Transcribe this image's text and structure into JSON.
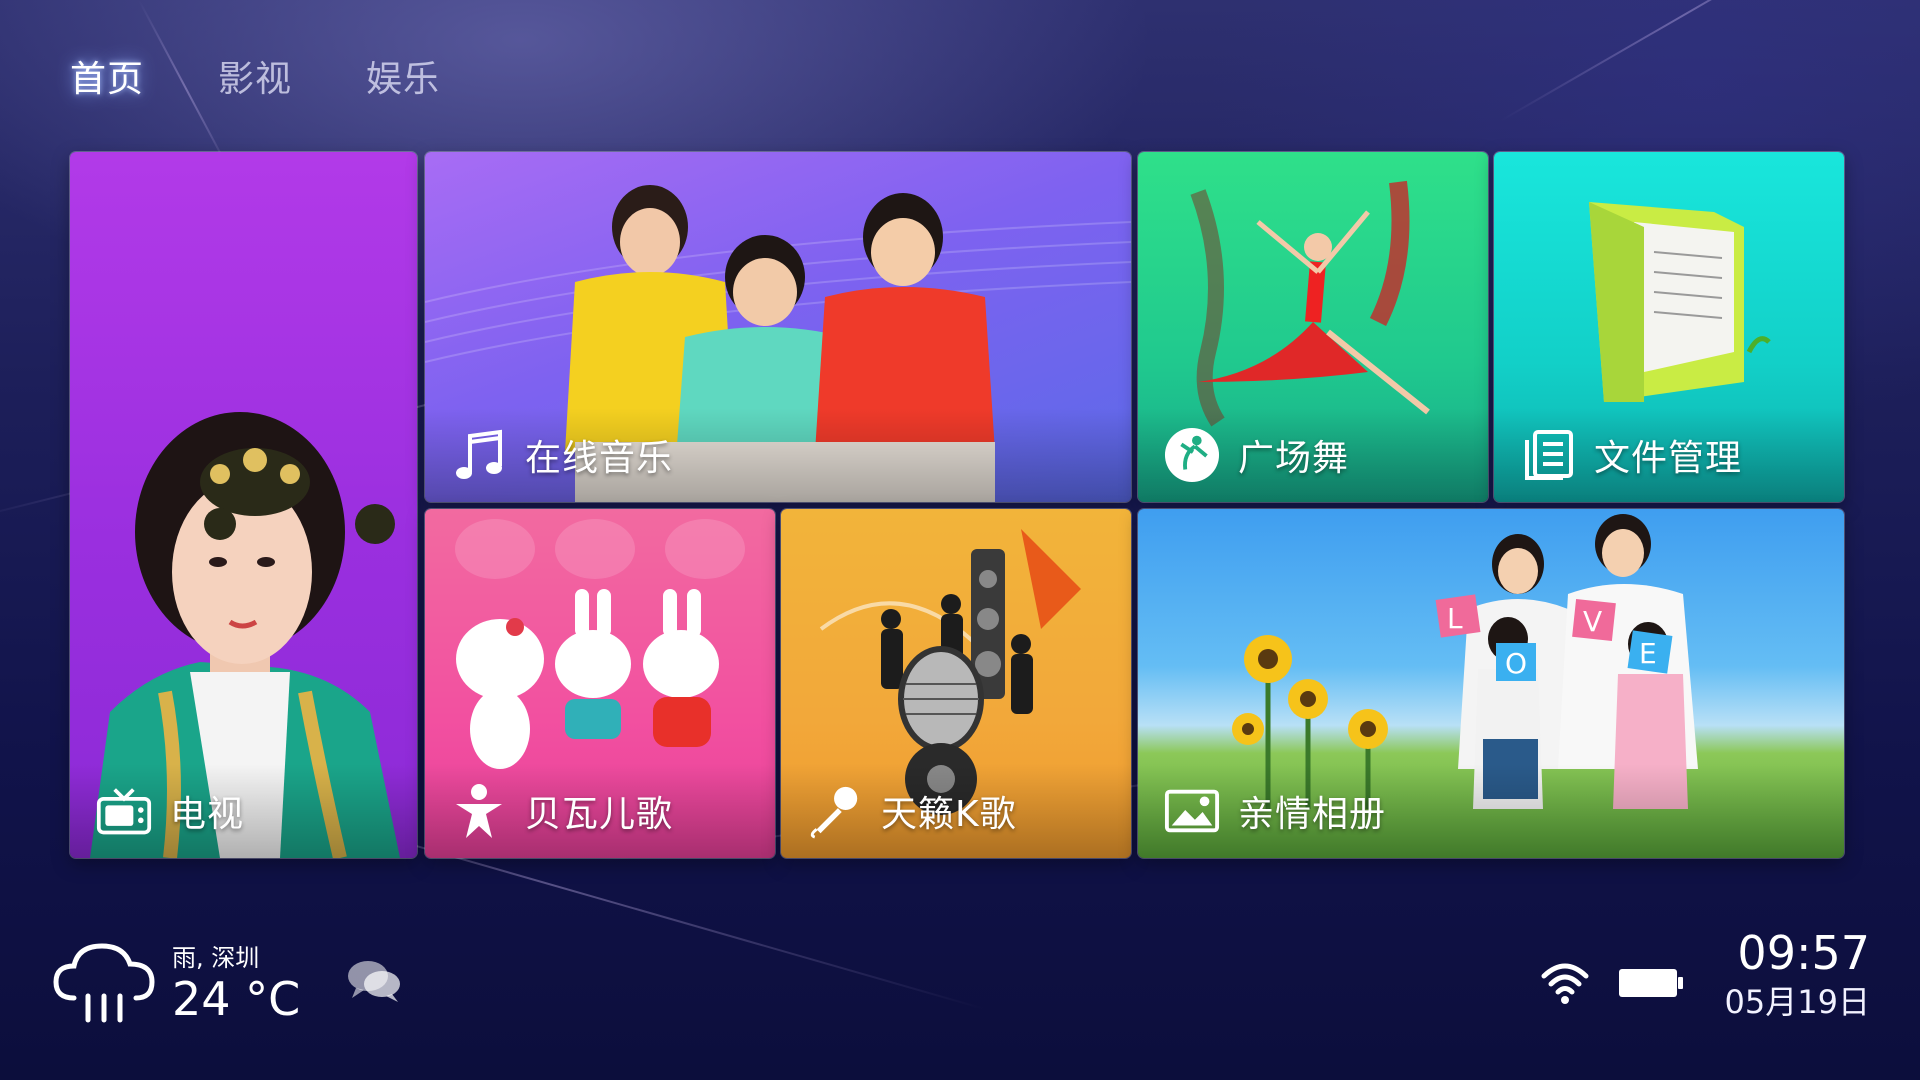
{
  "nav": {
    "tabs": [
      {
        "label": "首页",
        "active": true
      },
      {
        "label": "影视",
        "active": false
      },
      {
        "label": "娱乐",
        "active": false
      }
    ]
  },
  "tiles": {
    "tv": {
      "label": "电视",
      "icon": "tv-icon",
      "color": "#a033e0"
    },
    "music": {
      "label": "在线音乐",
      "icon": "music-note-icon",
      "color": "#7a60f0"
    },
    "dance": {
      "label": "广场舞",
      "icon": "dancer-icon",
      "color": "#1fcf8c"
    },
    "files": {
      "label": "文件管理",
      "icon": "file-list-icon",
      "color": "#16d4c8"
    },
    "kids": {
      "label": "贝瓦儿歌",
      "icon": "child-icon",
      "color": "#f050a0"
    },
    "karaoke": {
      "label": "天籁K歌",
      "icon": "microphone-icon",
      "color": "#f2a93a"
    },
    "album": {
      "label": "亲情相册",
      "icon": "photo-icon",
      "color": "#4aa8f0"
    }
  },
  "album_letters": [
    "L",
    "O",
    "V",
    "E"
  ],
  "status": {
    "weather_desc": "雨, 深圳",
    "weather_temp": "24 °C",
    "weather_icon": "rain-cloud-icon",
    "message_icon": "chat-bubbles-icon",
    "wifi_icon": "wifi-icon",
    "battery_icon": "battery-icon",
    "time": "09:57",
    "date": "05月19日"
  }
}
